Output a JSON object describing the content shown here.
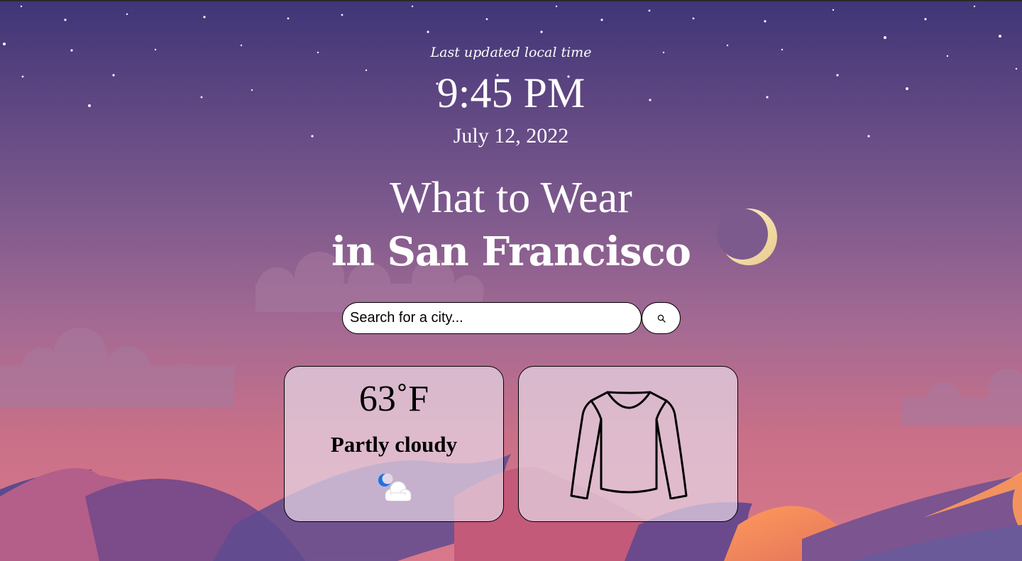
{
  "header": {
    "updated_label": "Last updated local time",
    "time": "9:45 PM",
    "date": "July 12, 2022"
  },
  "title": {
    "line1": "What to Wear",
    "line2": "in San Francisco"
  },
  "search": {
    "placeholder": "Search for a city...",
    "button_icon": "search-icon"
  },
  "weather": {
    "temperature": "63˚F",
    "condition": "Partly cloudy",
    "icon": "moon-cloud-icon"
  },
  "clothing": {
    "icon": "long-sleeve-shirt-icon"
  },
  "colors": {
    "sky_top": "#3f3577",
    "sky_bottom": "#d9788a",
    "card_bg": "#e6d7e6",
    "text": "#ffffff"
  }
}
